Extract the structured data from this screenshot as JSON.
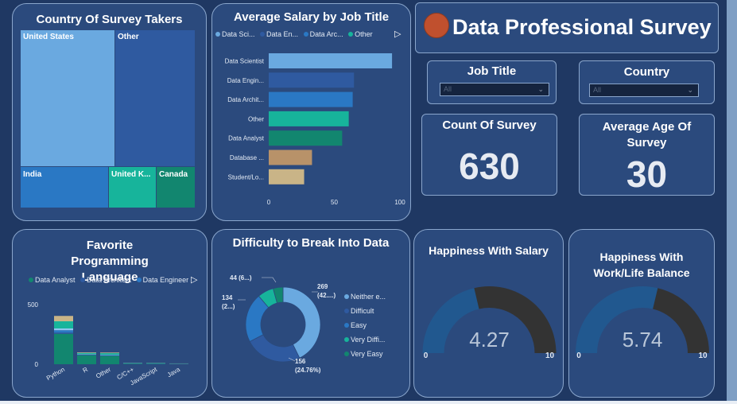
{
  "country_card": {
    "title": "Country Of Survey Takers",
    "tiles": [
      {
        "label": "United States",
        "color": "#6aa9e0"
      },
      {
        "label": "Other",
        "color": "#2f5aa0"
      },
      {
        "label": "India",
        "color": "#2a78c4"
      },
      {
        "label": "United K...",
        "color": "#17b49b"
      },
      {
        "label": "Canada",
        "color": "#12866f"
      }
    ]
  },
  "salary_card": {
    "title": "Average Salary by Job Title",
    "legend": [
      "Data Sci...",
      "Data En...",
      "Data Arc...",
      "Other"
    ],
    "legend_colors": [
      "#6aa9e0",
      "#2f5aa0",
      "#2a78c4",
      "#17b49b"
    ],
    "play_icon": "play-icon"
  },
  "header": {
    "title": "Data Professional Survey",
    "logo_color": "#c0502e"
  },
  "filters": {
    "job_title": {
      "label": "Job Title",
      "value": "All"
    },
    "country": {
      "label": "Country",
      "value": "All"
    }
  },
  "kpis": {
    "count": {
      "label": "Count Of Survey",
      "value": "630"
    },
    "age": {
      "label": "Average Age Of Survey",
      "value": "30"
    }
  },
  "lang_card": {
    "title": "Favorite Programming Language",
    "legend": [
      "Data Analyst",
      "Data Architect",
      "Data Engineer"
    ],
    "legend_colors": [
      "#12866f",
      "#2f5aa0",
      "#2a78c4"
    ]
  },
  "diff_card": {
    "title": "Difficulty to Break Into Data",
    "legend": [
      "Neither e...",
      "Difficult",
      "Easy",
      "Very Diffi...",
      "Very Easy"
    ],
    "legend_colors": [
      "#6aa9e0",
      "#2f5aa0",
      "#2a78c4",
      "#17b49b",
      "#12866f"
    ]
  },
  "happy_salary": {
    "title": "Happiness With Salary"
  },
  "happy_balance": {
    "title": "Happiness With Work/Life Balance"
  },
  "chart_data": [
    {
      "type": "bar",
      "orientation": "horizontal",
      "title": "Average Salary by Job Title",
      "categories": [
        "Data Scientist",
        "Data Engin...",
        "Data Archit...",
        "Other",
        "Data Analyst",
        "Database ...",
        "Student/Lo..."
      ],
      "values": [
        94,
        65,
        64,
        61,
        56,
        33,
        27
      ],
      "colors": [
        "#6aa9e0",
        "#2f5aa0",
        "#2a78c4",
        "#17b49b",
        "#12866f",
        "#b89269",
        "#c9b487"
      ],
      "ticks": [
        0,
        50,
        100
      ],
      "xlim": [
        0,
        100
      ]
    },
    {
      "type": "bar",
      "stacked": true,
      "title": "Favorite Programming Language",
      "categories": [
        "Python",
        "R",
        "Other",
        "C/C++",
        "JavaScript",
        "Java"
      ],
      "ticks": [
        0,
        500
      ],
      "ylim": [
        0,
        500
      ],
      "series": [
        {
          "name": "Data Analyst",
          "color": "#12866f",
          "values": [
            255,
            75,
            70,
            5,
            4,
            2
          ]
        },
        {
          "name": "Data Architect",
          "color": "#2f5aa0",
          "values": [
            10,
            3,
            3,
            1,
            1,
            1
          ]
        },
        {
          "name": "Data Engineer",
          "color": "#2a78c4",
          "values": [
            20,
            3,
            4,
            2,
            2,
            1
          ]
        },
        {
          "name": "",
          "color": "#8fc7f0",
          "values": [
            15,
            4,
            4,
            1,
            1,
            1
          ]
        },
        {
          "name": "",
          "color": "#17b49b",
          "values": [
            60,
            10,
            12,
            2,
            2,
            1
          ]
        },
        {
          "name": "",
          "color": "#c9b487",
          "values": [
            45,
            5,
            5,
            1,
            1,
            1
          ]
        }
      ]
    },
    {
      "type": "pie",
      "donut": true,
      "title": "Difficulty to Break Into Data",
      "slices": [
        {
          "label": "Neither e...",
          "value": 269,
          "color": "#6aa9e0"
        },
        {
          "label": "Difficult",
          "value": 156,
          "color": "#2f5aa0"
        },
        {
          "label": "Easy",
          "value": 134,
          "color": "#2a78c4"
        },
        {
          "label": "Very Diffi...",
          "value": 44,
          "color": "#17b49b"
        },
        {
          "label": "Very Easy",
          "value": 27,
          "color": "#12866f"
        }
      ],
      "data_labels": [
        "269",
        "(42....)",
        "156",
        "(24.76%)",
        "134",
        "(2...)",
        "44 (6...)"
      ]
    },
    {
      "type": "gauge",
      "title": "Happiness With Salary",
      "value": 4.27,
      "min": 0,
      "max": 10,
      "value_label": "4.27",
      "min_label": "0",
      "max_label": "10"
    },
    {
      "type": "gauge",
      "title": "Happiness With Work/Life Balance",
      "value": 5.74,
      "min": 0,
      "max": 10,
      "value_label": "5.74",
      "min_label": "0",
      "max_label": "10"
    }
  ]
}
